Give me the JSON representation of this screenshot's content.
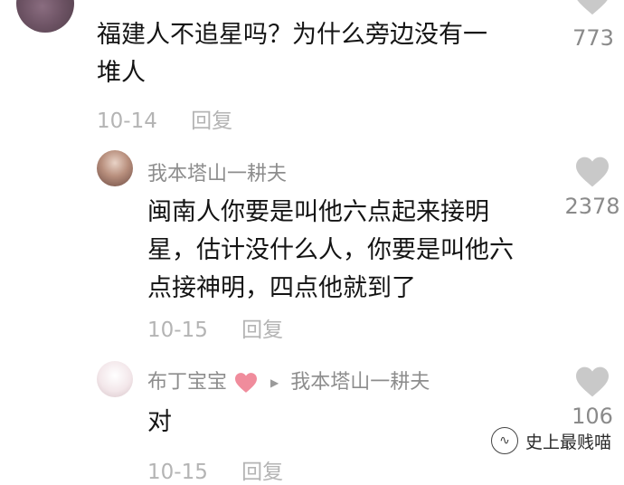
{
  "comments": [
    {
      "text_line1": "福建人不追星吗？为什么旁边没有一",
      "text_line2": "堆人",
      "date": "10-14",
      "reply_label": "回复",
      "likes": "773"
    },
    {
      "username": "我本塔山一耕夫",
      "text_line1": "闽南人你要是叫他六点起来接明",
      "text_line2": "星，估计没什么人，你要是叫他六",
      "text_line3": "点接神明，四点他就到了",
      "date": "10-15",
      "reply_label": "回复",
      "likes": "2378"
    },
    {
      "username": "布丁宝宝",
      "reply_to": "我本塔山一耕夫",
      "text_line1": "对",
      "date": "10-15",
      "reply_label": "回复",
      "likes": "106"
    }
  ],
  "watermark": {
    "text": "史上最贱喵"
  },
  "colors": {
    "heart": "#c9c9c9",
    "pink_heart": "#f08c9c",
    "meta": "#b4b4b4"
  }
}
